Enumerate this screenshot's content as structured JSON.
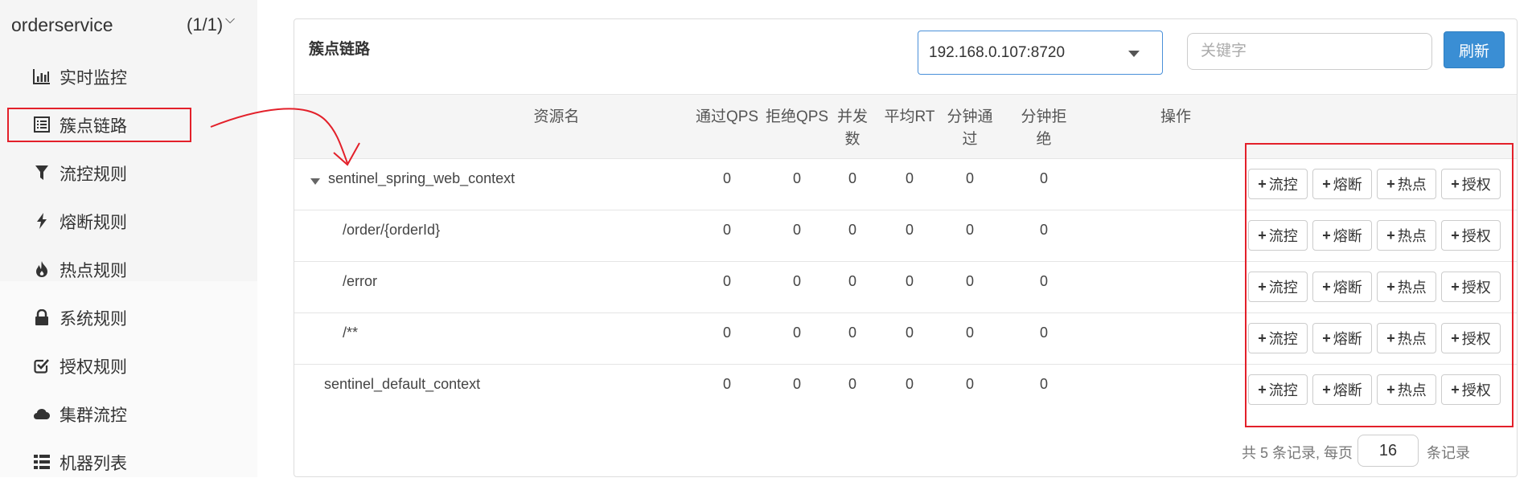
{
  "sidebar": {
    "app_name": "orderservice",
    "app_count": "(1/1)",
    "items": [
      {
        "label": "实时监控",
        "icon": "bar-chart-icon"
      },
      {
        "label": "簇点链路",
        "icon": "list-icon"
      },
      {
        "label": "流控规则",
        "icon": "filter-icon"
      },
      {
        "label": "熔断规则",
        "icon": "bolt-icon"
      },
      {
        "label": "热点规则",
        "icon": "fire-icon"
      },
      {
        "label": "系统规则",
        "icon": "lock-icon"
      },
      {
        "label": "授权规则",
        "icon": "check-square-icon"
      },
      {
        "label": "集群流控",
        "icon": "cloud-icon"
      },
      {
        "label": "机器列表",
        "icon": "th-list-icon"
      }
    ],
    "active_item": "簇点链路"
  },
  "panel": {
    "title": "簇点链路",
    "machine_select_value": "192.168.0.107:8720",
    "keyword_placeholder": "关键字",
    "refresh_label": "刷新"
  },
  "table": {
    "headers": {
      "name": "资源名",
      "pass_qps": "通过QPS",
      "block_qps": "拒绝QPS",
      "concurrency": "并发数",
      "avg_rt": "平均RT",
      "minute_pass": "分钟通过",
      "minute_block": "分钟拒绝",
      "ops": "操作"
    },
    "rows": [
      {
        "name": "sentinel_spring_web_context",
        "pass_qps": "0",
        "block_qps": "0",
        "concurrency": "0",
        "avg_rt": "0",
        "minute_pass": "0",
        "minute_block": "0"
      },
      {
        "name": "/order/{orderId}",
        "pass_qps": "0",
        "block_qps": "0",
        "concurrency": "0",
        "avg_rt": "0",
        "minute_pass": "0",
        "minute_block": "0"
      },
      {
        "name": "/error",
        "pass_qps": "0",
        "block_qps": "0",
        "concurrency": "0",
        "avg_rt": "0",
        "minute_pass": "0",
        "minute_block": "0"
      },
      {
        "name": "/**",
        "pass_qps": "0",
        "block_qps": "0",
        "concurrency": "0",
        "avg_rt": "0",
        "minute_pass": "0",
        "minute_block": "0"
      },
      {
        "name": "sentinel_default_context",
        "pass_qps": "0",
        "block_qps": "0",
        "concurrency": "0",
        "avg_rt": "0",
        "minute_pass": "0",
        "minute_block": "0"
      }
    ],
    "op_labels": {
      "flow": "流控",
      "degrade": "熔断",
      "hotspot": "热点",
      "authority": "授权"
    }
  },
  "pager": {
    "text_before": "共 5 条记录, 每页",
    "page_size": "16",
    "text_after": "条记录"
  },
  "colors": {
    "annotation_red": "#e3202a",
    "primary_blue": "#3a8ed4"
  }
}
